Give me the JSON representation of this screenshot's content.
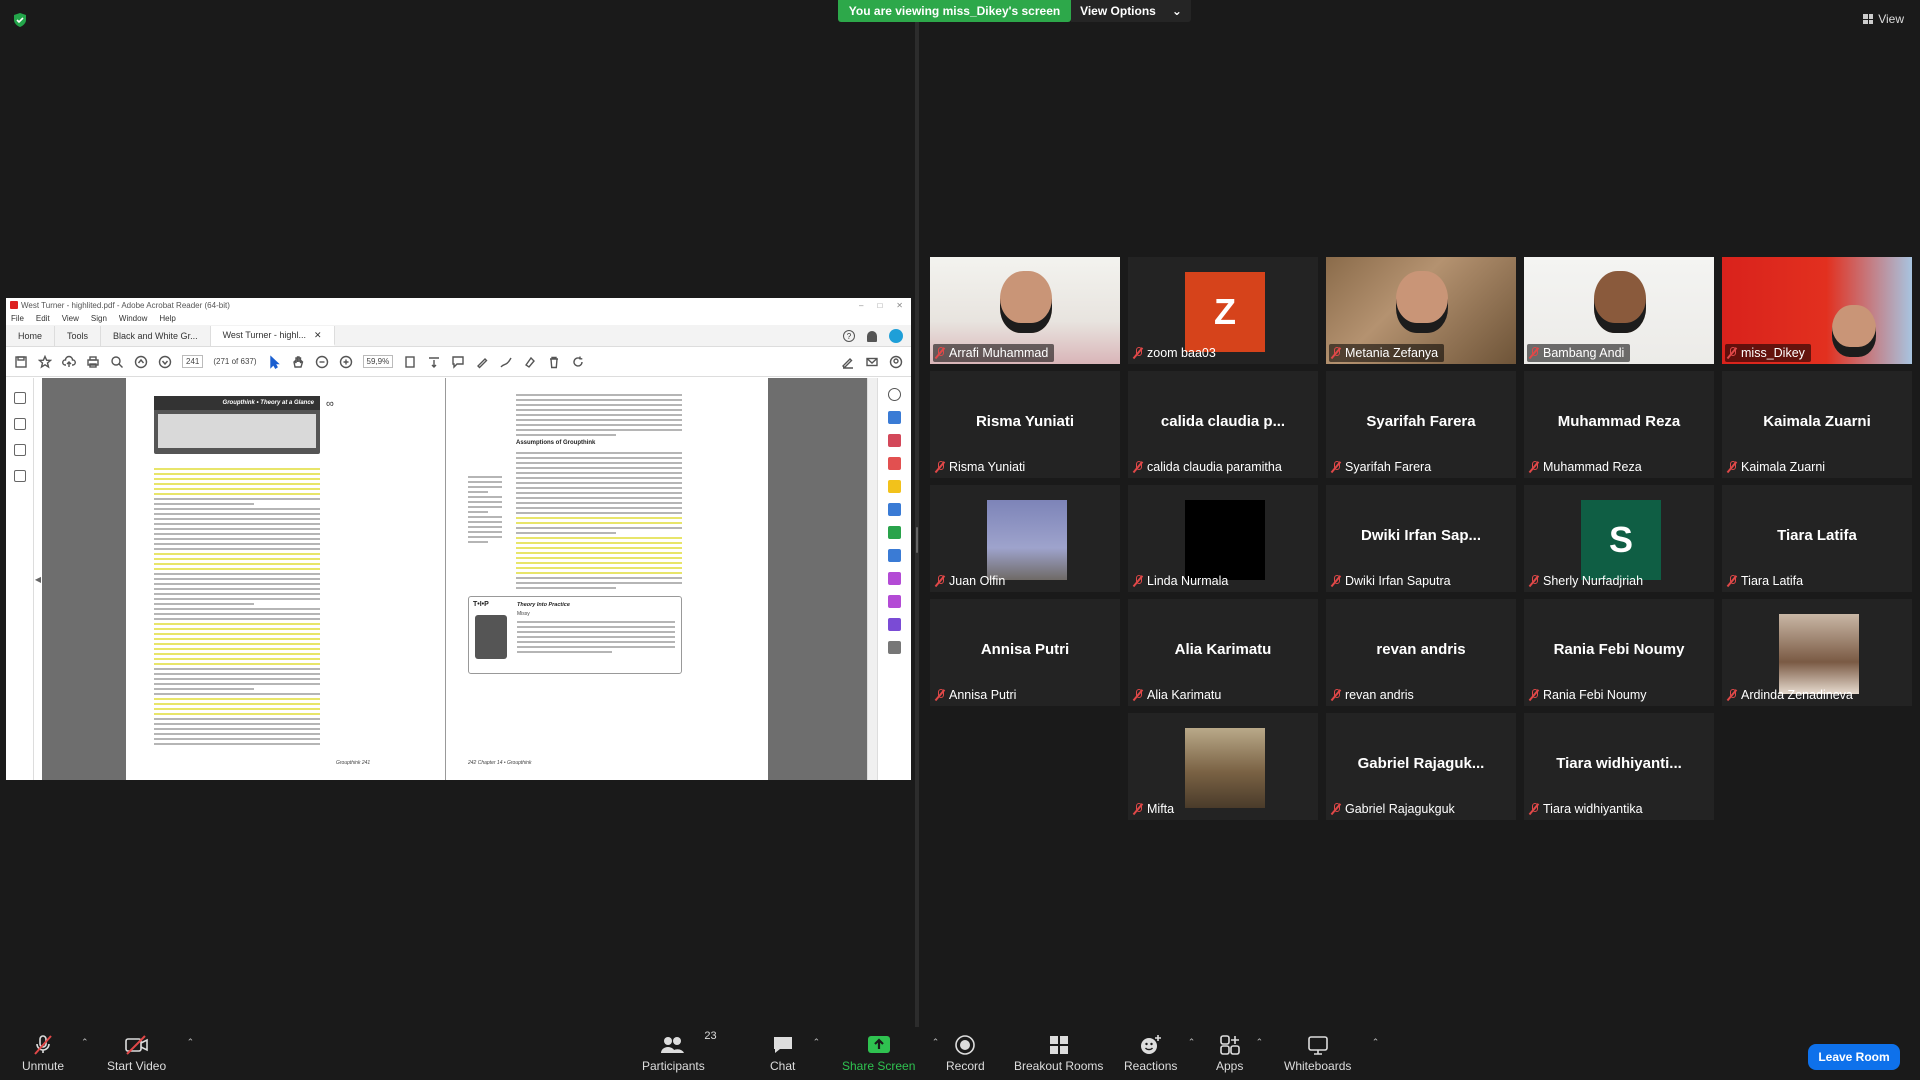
{
  "top": {
    "viewing_banner": "You are viewing miss_Dikey's screen",
    "view_options": "View Options",
    "view": "View"
  },
  "acrobat": {
    "window_title": "West Turner - highlited.pdf - Adobe Acrobat Reader (64-bit)",
    "menu": [
      "File",
      "Edit",
      "View",
      "Sign",
      "Window",
      "Help"
    ],
    "tabs": [
      "Home",
      "Tools",
      "Black and White Gr...",
      "West Turner - highl..."
    ],
    "page_number": "241",
    "page_count": "(271 of 637)",
    "zoom": "59,9%",
    "page1_header": "Groupthink • Theory at a Glance",
    "page1_footer": "Groupthink  241",
    "page2_heading": "Assumptions of Groupthink",
    "page2_tip": "T•I•P",
    "page2_tip_title": "Theory Into Practice",
    "page2_tip_author": "Missy",
    "page2_footer": "242  Chapter 14 • Groupthink"
  },
  "participants": [
    {
      "name": "Arrafi Muhammad",
      "kind": "video"
    },
    {
      "name": "zoom baa03",
      "kind": "letter",
      "letter": "Z",
      "color": "#d6431b"
    },
    {
      "name": "Metania Zefanya",
      "kind": "video"
    },
    {
      "name": "Bambang Andi",
      "kind": "video"
    },
    {
      "name": "miss_Dikey",
      "kind": "video"
    },
    {
      "name": "Risma Yuniati",
      "display": "Risma Yuniati",
      "kind": "text"
    },
    {
      "name": "calida claudia paramitha",
      "display": "calida  claudia  p...",
      "kind": "text"
    },
    {
      "name": "Syarifah Farera",
      "display": "Syarifah Farera",
      "kind": "text"
    },
    {
      "name": "Muhammad Reza",
      "display": "Muhammad Reza",
      "kind": "text"
    },
    {
      "name": "Kaimala Zuarni",
      "display": "Kaimala Zuarni",
      "kind": "text"
    },
    {
      "name": "Juan Olfin",
      "kind": "pic"
    },
    {
      "name": "Linda Nurmala",
      "kind": "pic"
    },
    {
      "name": "Dwiki Irfan Saputra",
      "display": "Dwiki  Irfan  Sap...",
      "kind": "text"
    },
    {
      "name": "Sherly Nurfadjriah",
      "kind": "letter",
      "letter": "S",
      "color": "#0f5e44"
    },
    {
      "name": "Tiara Latifa",
      "display": "Tiara Latifa",
      "kind": "text"
    },
    {
      "name": "Annisa Putri",
      "display": "Annisa Putri",
      "kind": "text"
    },
    {
      "name": "Alia Karimatu",
      "display": "Alia Karimatu",
      "kind": "text"
    },
    {
      "name": "revan andris",
      "display": "revan andris",
      "kind": "text"
    },
    {
      "name": "Rania Febi Noumy",
      "display": "Rania Febi Noumy",
      "kind": "text"
    },
    {
      "name": "Ardinda Zenadineva",
      "kind": "pic"
    },
    {
      "name": "Mifta",
      "kind": "pic"
    },
    {
      "name": "Gabriel Rajagukguk",
      "display": "Gabriel  Rajaguk...",
      "kind": "text"
    },
    {
      "name": "Tiara widhiyantika",
      "display": "Tiara  widhiyanti...",
      "kind": "text"
    }
  ],
  "controls": {
    "unmute": "Unmute",
    "start_video": "Start Video",
    "participants": "Participants",
    "participant_count": "23",
    "chat": "Chat",
    "share_screen": "Share Screen",
    "record": "Record",
    "breakout_rooms": "Breakout Rooms",
    "reactions": "Reactions",
    "apps": "Apps",
    "whiteboards": "Whiteboards",
    "leave_room": "Leave Room"
  },
  "colors": {
    "share_green": "#2da84a",
    "leave_blue": "#0e71eb",
    "active_speaker": "#f2d31b",
    "mute_red": "#e04848"
  }
}
